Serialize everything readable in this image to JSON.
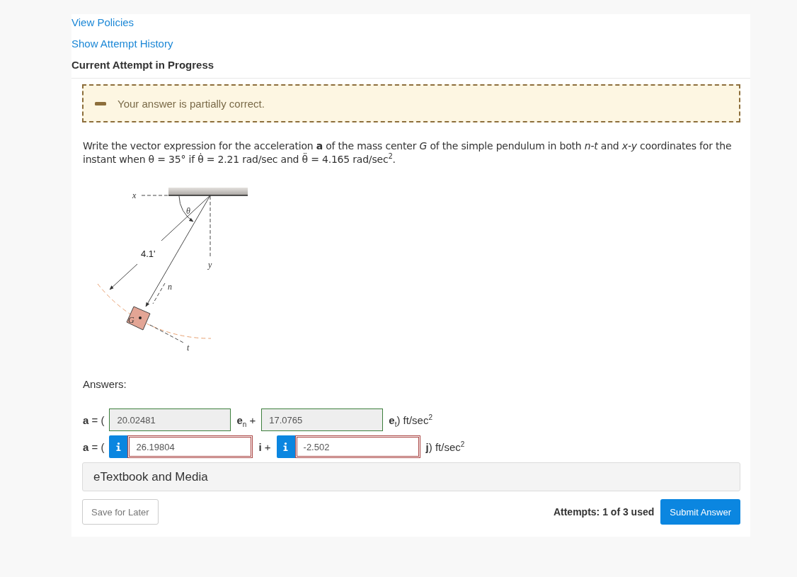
{
  "links": [
    {
      "label": "View Policies"
    },
    {
      "label": "Show Attempt History"
    }
  ],
  "heading": "Current Attempt in Progress",
  "feedback": {
    "kind": "partial",
    "message": "Your answer is partially correct."
  },
  "question": {
    "text": "Write the vector expression for the acceleration **a** of the mass center *G* of the simple pendulum in both *n-t* and *x-y* coordinates for the instant when θ = 35° if θ̇ = 2.21 rad/sec and θ̈ = 4.165 rad/sec$^{2}$.",
    "figure": {
      "x_axis": "x",
      "angle": "θ",
      "length": "4.1'",
      "y_axis": "y",
      "normal": "n",
      "mass_center": "G",
      "tangent": "t"
    }
  },
  "answers": {
    "label": "Answers:",
    "rows": [
      {
        "prefix": "**a** = (",
        "terms": [
          {
            "value": "20.02481",
            "correct": true,
            "unit": "**e**$_{n}$ +"
          },
          {
            "value": "17.0765",
            "correct": true,
            "unit": "**e**$_{t}$) ft/sec$^{2}$"
          }
        ]
      },
      {
        "prefix": "**a** = (",
        "terms": [
          {
            "value": "26.19804",
            "correct": false,
            "unit": "**i** +"
          },
          {
            "value": "-2.502",
            "correct": false,
            "unit": "**j**) ft/sec$^{2}$"
          }
        ]
      }
    ]
  },
  "resources": {
    "label": "eTextbook and Media"
  },
  "footer": {
    "save_button": "Save for Later",
    "attempts": "Attempts: 1 of 3 used",
    "submit_button": "Submit Answer"
  }
}
